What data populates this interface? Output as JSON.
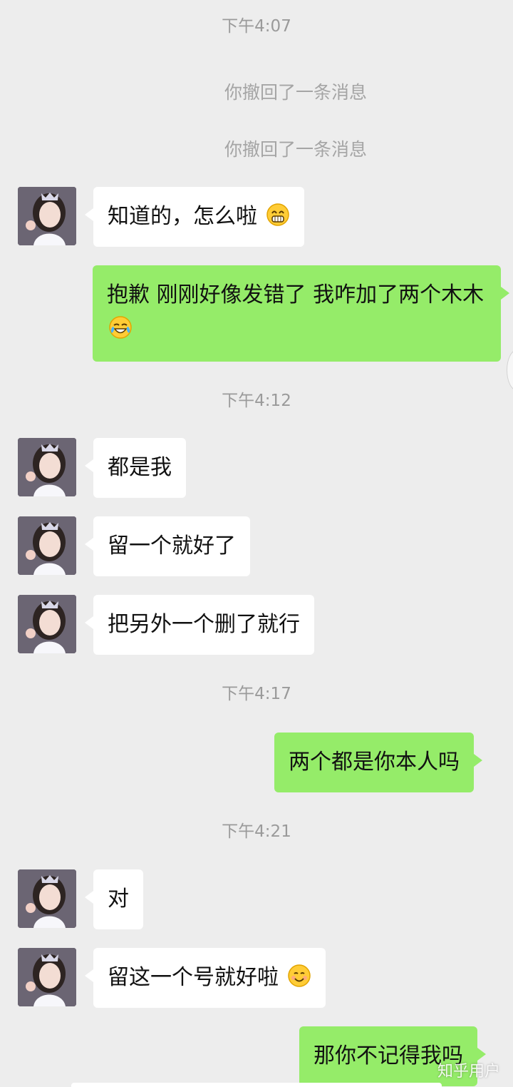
{
  "chat": {
    "items": [
      {
        "type": "time",
        "text": "下午4:07"
      },
      {
        "type": "recall",
        "text": "你撤回了一条消息"
      },
      {
        "type": "recall",
        "text": "你撤回了一条消息"
      },
      {
        "type": "message",
        "direction": "incoming",
        "text": "知道的，怎么啦",
        "emoji": "grin-emoji"
      },
      {
        "type": "message",
        "direction": "outgoing",
        "text": "抱歉 刚刚好像发错了 我咋加了两个木木",
        "emoji": "tears-of-joy-emoji"
      },
      {
        "type": "time",
        "text": "下午4:12"
      },
      {
        "type": "message",
        "direction": "incoming",
        "text": "都是我"
      },
      {
        "type": "message",
        "direction": "incoming",
        "text": "留一个就好了"
      },
      {
        "type": "message",
        "direction": "incoming",
        "text": "把另外一个删了就行"
      },
      {
        "type": "time",
        "text": "下午4:17"
      },
      {
        "type": "message",
        "direction": "outgoing",
        "text": "两个都是你本人吗"
      },
      {
        "type": "time",
        "text": "下午4:21"
      },
      {
        "type": "message",
        "direction": "incoming",
        "text": "对"
      },
      {
        "type": "message",
        "direction": "incoming",
        "text": "留这一个号就好啦",
        "emoji": "smile-emoji"
      },
      {
        "type": "message",
        "direction": "outgoing",
        "text": "那你不记得我吗"
      }
    ]
  },
  "colors": {
    "background": "#ededed",
    "incoming_bubble": "#ffffff",
    "outgoing_bubble": "#95ec69",
    "timestamp": "#9a9a9a"
  },
  "watermark": "知乎用户"
}
